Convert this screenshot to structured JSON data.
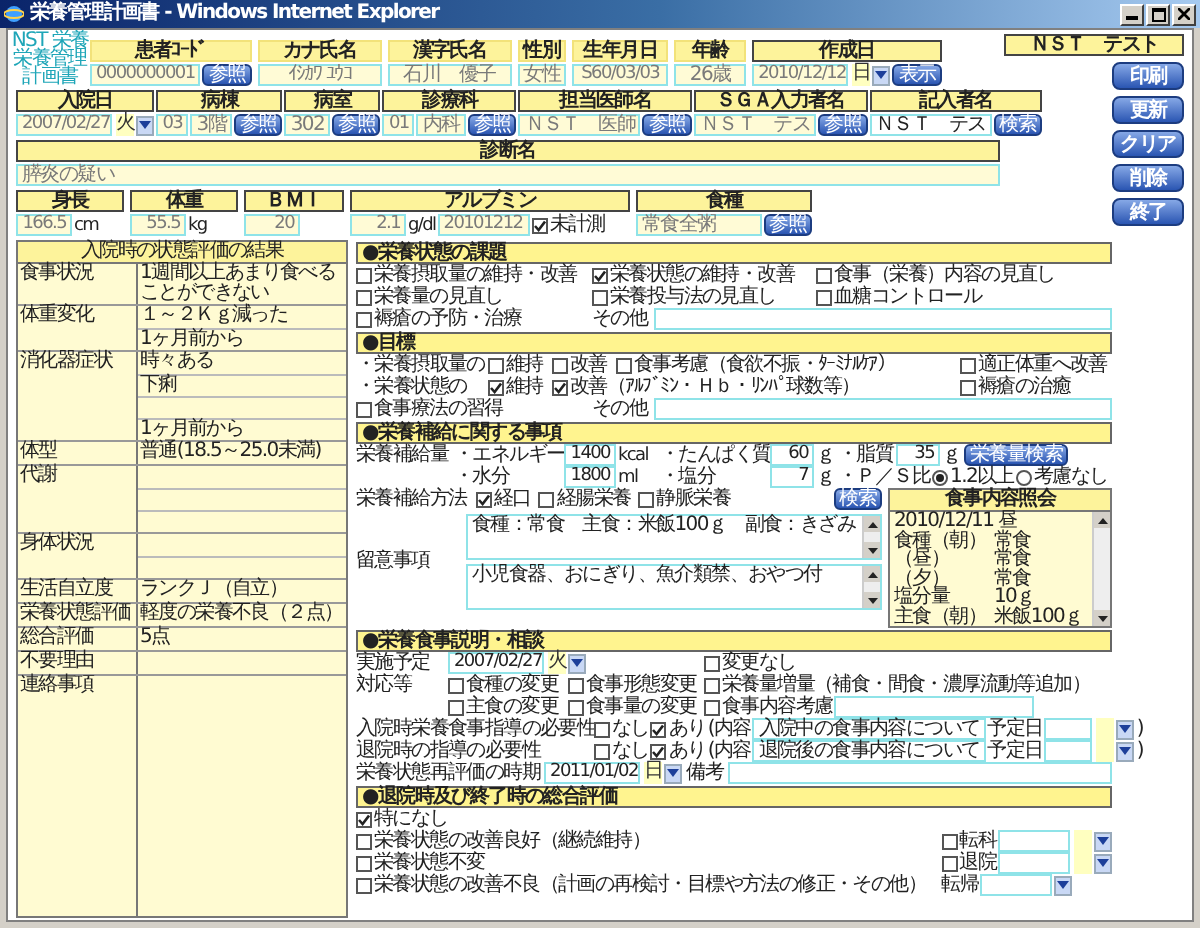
{
  "window": {
    "title": "栄養管理計画書 - Windows Internet Explorer"
  },
  "logo": [
    "NST 栄養",
    "栄養管理",
    "計画書"
  ],
  "patient": [
    {
      "header": "患者ｺｰﾄﾞ",
      "value": "0000000001",
      "button": "参照"
    },
    {
      "header": "カナ氏名",
      "value": "ｲｼｶﾜ ﾕｳｺ"
    },
    {
      "header": "漢字氏名",
      "value": "石川　優子"
    },
    {
      "header": "性別",
      "value": "女性"
    },
    {
      "header": "生年月日",
      "value": "S60/03/03"
    },
    {
      "header": "年齢",
      "value": "26歳"
    }
  ],
  "created": {
    "header": "作成日",
    "date": "2010/12/12",
    "weekday": "日",
    "button": "表示"
  },
  "user": "ＮＳＴ　テスト",
  "actions": [
    "印刷",
    "更新",
    "クリア",
    "削除",
    "終了"
  ],
  "admission": [
    {
      "kind": "date",
      "header": "入院日",
      "date": "2007/02/27",
      "weekday": "火"
    },
    {
      "kind": "lookup",
      "header": "病棟",
      "code": "03",
      "value": "3階",
      "button": "参照",
      "disabled": true
    },
    {
      "kind": "lookup",
      "header": "病室",
      "value": "302",
      "button": "参照",
      "disabled": true
    },
    {
      "kind": "lookup",
      "header": "診療科",
      "code": "01",
      "value": "内科",
      "button": "参照",
      "disabled": true
    },
    {
      "kind": "lookup",
      "header": "担当医師名",
      "value": "ＮＳＴ　医師",
      "button": "参照",
      "disabled": true
    },
    {
      "kind": "lookup",
      "header": "ＳＧＡ入力者名",
      "value": "ＮＳＴ　テス",
      "button": "参照",
      "disabled": true
    },
    {
      "kind": "lookup",
      "header": "記入者名",
      "value": "ＮＳＴ　テス",
      "button": "検索",
      "disabled": false
    }
  ],
  "diagnosis": {
    "header": "診断名",
    "value": "膵炎の疑い"
  },
  "measures": [
    {
      "header": "身長",
      "value": "166.5",
      "unit": "cm"
    },
    {
      "header": "体重",
      "value": "55.5",
      "unit": "kg"
    },
    {
      "header": "ＢＭＩ",
      "value": "20"
    },
    {
      "header": "アルブミン",
      "value": "2.1",
      "unit": "g/dl",
      "date": "20101212",
      "check": {
        "label": "未計測",
        "checked": true
      }
    },
    {
      "header": "食種",
      "value": "常食全粥",
      "button": "参照"
    }
  ],
  "assessment": {
    "title": "入院時の状態評価の結果",
    "rows": [
      {
        "label": "食事状況",
        "lines": [
          "1週間以上あまり食べることができない"
        ]
      },
      {
        "label": "体重変化",
        "lines": [
          "１～２Ｋｇ減った",
          "1ヶ月前から"
        ]
      },
      {
        "label": "消化器症状",
        "kind": "split",
        "lines": [
          "時々ある",
          "下痢"
        ],
        "since": "1ヶ月前から"
      },
      {
        "label": "体型",
        "lines": [
          "普通(18.5～25.0未満)"
        ]
      },
      {
        "label": "代謝",
        "kind": "triple"
      },
      {
        "label": "身体状況",
        "kind": "double"
      },
      {
        "label": "生活自立度",
        "lines": [
          "ランクＪ（自立）"
        ]
      },
      {
        "label": "栄養状態評価",
        "lines": [
          "軽度の栄養不良（２点）"
        ]
      },
      {
        "label": "総合評価",
        "lines": [
          "5点"
        ]
      },
      {
        "label": "不要理由",
        "kind": "single"
      },
      {
        "label": "連絡事項",
        "kind": "fill"
      }
    ]
  },
  "issues": {
    "title": "●栄養状態の課題",
    "options": [
      {
        "label": "栄養摂取量の維持・改善",
        "checked": false
      },
      {
        "label": "栄養状態の維持・改善",
        "checked": true
      },
      {
        "label": "食事（栄養）内容の見直し",
        "checked": false
      },
      {
        "label": "栄養量の見直し",
        "checked": false
      },
      {
        "label": "栄養投与法の見直し",
        "checked": false
      },
      {
        "label": "血糖コントロール",
        "checked": false
      },
      {
        "label": "褥瘡の予防・治療",
        "checked": false
      }
    ],
    "other": "その他"
  },
  "goals": {
    "title": "●目標",
    "rows": [
      {
        "label": "・栄養摂取量の",
        "options": [
          {
            "label": "維持",
            "checked": false
          },
          {
            "label": "改善",
            "checked": false
          },
          {
            "label": "食事考慮（食欲不振・ﾀｰﾐﾅﾙｹｱ）",
            "checked": false
          },
          {
            "label": "適正体重へ改善",
            "checked": false
          }
        ]
      },
      {
        "label": "・栄養状態の",
        "options": [
          {
            "label": "維持",
            "checked": true
          },
          {
            "label": "改善（ｱﾙﾌﾞﾐﾝ・Ｈｂ・ﾘﾝﾊﾟ球数等）",
            "checked": true
          },
          {
            "label": "褥瘡の治癒",
            "checked": false
          }
        ]
      }
    ],
    "extra": {
      "label": "食事療法の習得",
      "checked": false
    },
    "other": "その他"
  },
  "supply": {
    "title": "●栄養補給に関する事項",
    "amount_label": "栄養補給量",
    "items": [
      {
        "label": "・エネルギー",
        "value": "1400",
        "unit": "kcal"
      },
      {
        "label": "・たんぱく質",
        "value": "60",
        "unit": "ｇ"
      },
      {
        "label": "・脂質",
        "value": "35",
        "unit": "ｇ"
      },
      {
        "label": "・水分",
        "value": "1800",
        "unit": "ml"
      },
      {
        "label": "・塩分",
        "value": "7",
        "unit": "ｇ"
      }
    ],
    "search_button": "栄養量検索",
    "ps": {
      "label": "・Ｐ／Ｓ比",
      "options": [
        {
          "label": "1.2以上",
          "selected": true
        },
        {
          "label": "考慮なし",
          "selected": false
        }
      ]
    },
    "method": {
      "label": "栄養補給方法",
      "options": [
        {
          "label": "経口",
          "checked": true
        },
        {
          "label": "経腸栄養",
          "checked": false
        },
        {
          "label": "静脈栄養",
          "checked": false
        }
      ],
      "button": "検索"
    },
    "notes": {
      "label": "留意事項",
      "texts": [
        "食種：常食　主食：米飯100ｇ　副食：きざみ",
        "小児食器、おにぎり、魚介類禁、おやつ付"
      ]
    },
    "menu": {
      "title": "食事内容照会",
      "lines": [
        {
          "label": "2010/12/11 昼"
        },
        {
          "label": "食種（朝）",
          "value": "常食"
        },
        {
          "label": "（昼）",
          "value": "常食"
        },
        {
          "label": "（夕）",
          "value": "常食"
        },
        {
          "label": "塩分量",
          "value": "10ｇ"
        },
        {
          "label": "主食（朝）",
          "value": "米飯100ｇ"
        }
      ]
    }
  },
  "counsel": {
    "title": "●栄養食事説明・相談",
    "plan": {
      "label": "実施予定",
      "date": "2007/02/27",
      "weekday": "火"
    },
    "no_change": {
      "label": "変更なし",
      "checked": false
    },
    "actions_label": "対応等",
    "actions": [
      {
        "label": "食種の変更",
        "checked": false
      },
      {
        "label": "食事形態変更",
        "checked": false
      },
      {
        "label": "栄養量増量（補食・間食・濃厚流動等追加）",
        "checked": false
      },
      {
        "label": "主食の変更",
        "checked": false
      },
      {
        "label": "食事量の変更",
        "checked": false
      },
      {
        "label": "食事内容考慮",
        "checked": false
      }
    ],
    "needs": [
      {
        "label": "入院時栄養食事指導の必要性",
        "options": [
          {
            "label": "なし",
            "checked": false
          },
          {
            "label": "あり",
            "checked": true
          }
        ],
        "content_label": "(内容",
        "content": "入院中の食事内容について",
        "date_label": "予定日",
        "close": ")"
      },
      {
        "label": "退院時の指導の必要性",
        "options": [
          {
            "label": "なし",
            "checked": false
          },
          {
            "label": "あり",
            "checked": true
          }
        ],
        "content_label": "(内容",
        "content": "退院後の食事内容について",
        "date_label": "予定日",
        "close": ")"
      }
    ],
    "reassess": {
      "label": "栄養状態再評価の時期",
      "date": "2011/01/02",
      "weekday": "日",
      "note_label": "備考"
    }
  },
  "final": {
    "title": "●退院時及び終了時の総合評価",
    "options": [
      {
        "label": "特になし",
        "checked": true
      },
      {
        "label": "栄養状態の改善良好（継続維持）",
        "checked": false
      },
      {
        "label": "栄養状態不変",
        "checked": false
      },
      {
        "label": "栄養状態の改善不良（計画の再検討・目標や方法の修正・その他）",
        "checked": false
      }
    ],
    "transfer": [
      {
        "label": "転科",
        "checked": false
      },
      {
        "label": "退院",
        "checked": false
      }
    ],
    "outcome_label": "転帰"
  }
}
